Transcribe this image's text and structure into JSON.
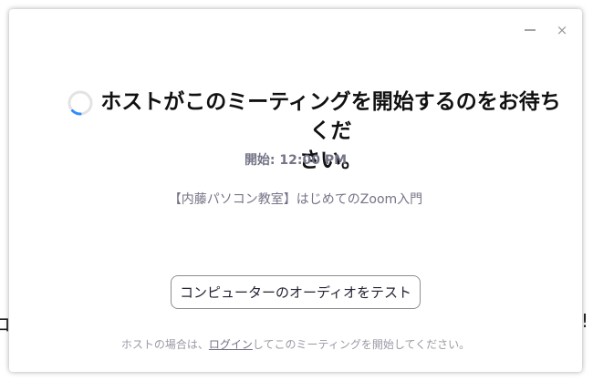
{
  "background": {
    "left_fragment": "コ",
    "right_fragment": "!"
  },
  "window_controls": {
    "minimize_icon": "minimize-icon",
    "close_icon": "close-icon",
    "close_glyph": "×"
  },
  "waiting": {
    "spinner_icon": "loading-spinner-icon",
    "spinner_color": "#2D8CFF",
    "title_line1": "ホストがこのミーティングを開始するのをお待ちくだ",
    "title_line2": "さい。",
    "start_time": "開始: 12:00 PM",
    "meeting_name": "【内藤パソコン教室】はじめてのZoom入門"
  },
  "actions": {
    "test_audio_label": "コンピューターのオーディオをテスト"
  },
  "footer": {
    "prefix": "ホストの場合は、",
    "login_link": "ログイン",
    "suffix": "してこのミーティングを開始してください。"
  }
}
